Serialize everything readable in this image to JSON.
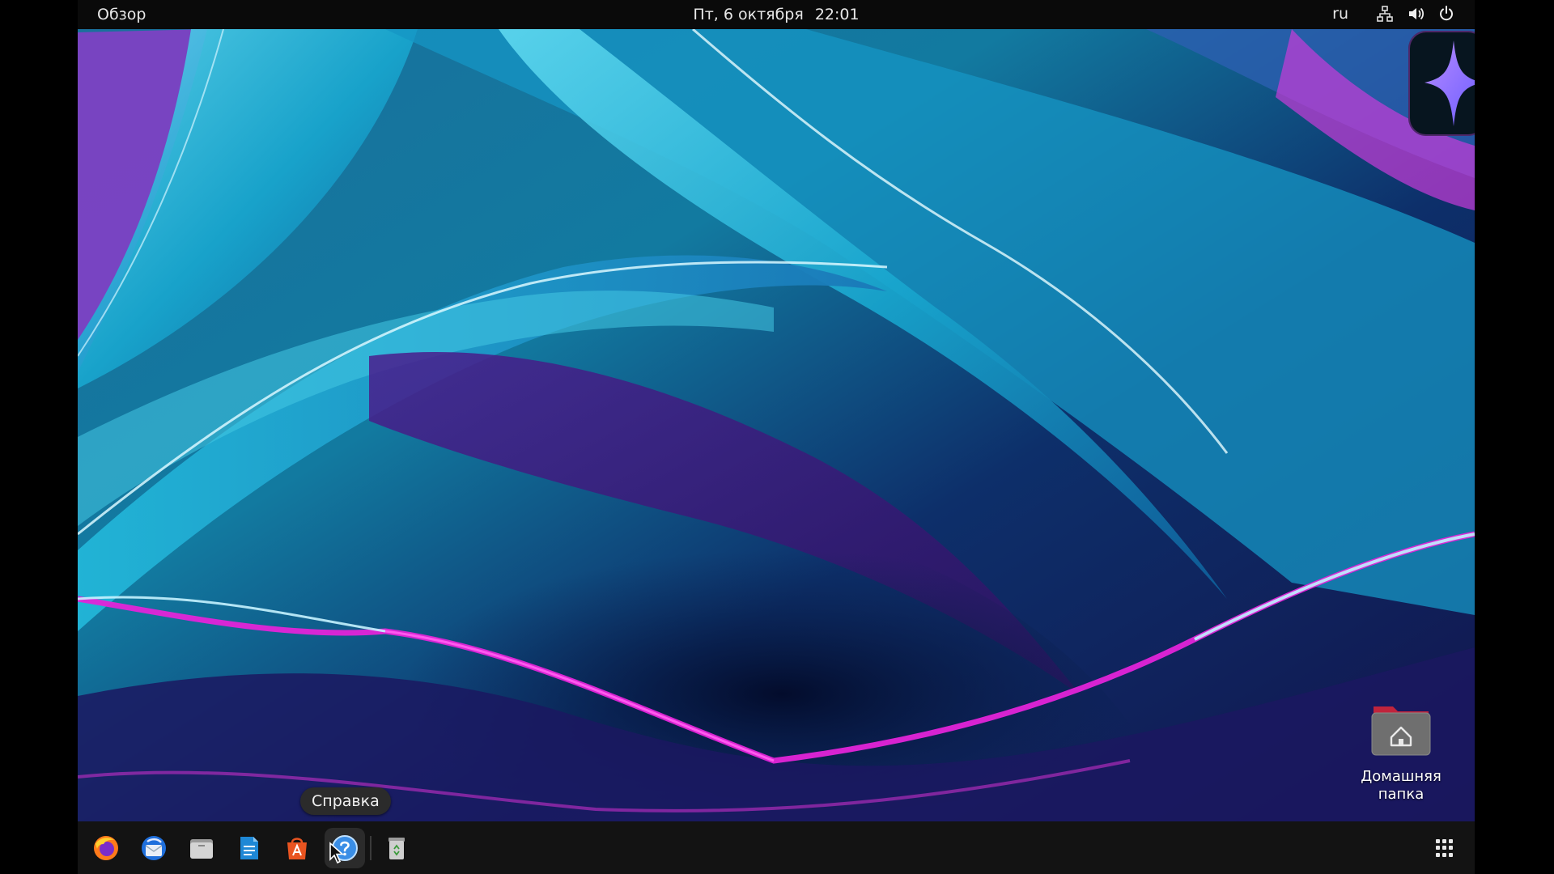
{
  "topbar": {
    "activities": "Обзор",
    "date": "Пт, 6 октября",
    "time": "22:01",
    "language": "ru",
    "icons": [
      "network-icon",
      "volume-icon",
      "power-icon"
    ]
  },
  "dock": {
    "items": [
      {
        "name": "firefox",
        "icon": "firefox-icon"
      },
      {
        "name": "thunderbird",
        "icon": "thunderbird-icon"
      },
      {
        "name": "files",
        "icon": "files-icon"
      },
      {
        "name": "writer",
        "icon": "writer-icon"
      },
      {
        "name": "app-center",
        "icon": "app-center-icon"
      },
      {
        "name": "help",
        "icon": "help-icon",
        "active": true
      },
      {
        "name": "trash",
        "icon": "trash-icon"
      }
    ],
    "show_apps_icon": "apps-grid-icon"
  },
  "tooltip": {
    "label": "Справка"
  },
  "desktop": {
    "home_folder_label_line1": "Домашняя",
    "home_folder_label_line2": "папка"
  },
  "colors": {
    "topbar": "#0a0a0a",
    "dock": "#131313",
    "accent": "#e95420",
    "wallpaper_cyan": "#1fb8d6",
    "wallpaper_magenta": "#e020d8",
    "wallpaper_purple": "#5a2a9a"
  }
}
